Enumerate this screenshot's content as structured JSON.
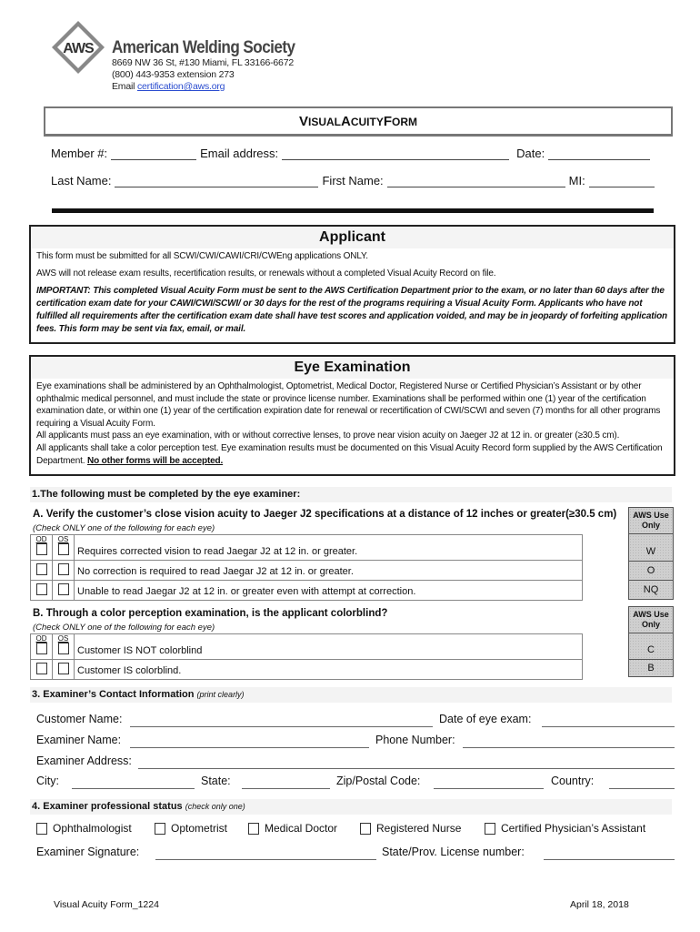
{
  "header": {
    "logo_text": "AWS",
    "org_name": "American Welding Society",
    "address": "8669 NW 36 St, #130 Miami, FL 33166-6672",
    "phone": "(800) 443-9353 extension 273",
    "email_label": "Email",
    "email": "certification@aws.org"
  },
  "form_title": {
    "first_v": "V",
    "rest1": "ISUAL ",
    "first_a": "A",
    "rest2": "CUITY ",
    "first_f": "F",
    "rest3": "ORM"
  },
  "top_fields": {
    "member": "Member #:",
    "email": "Email address:",
    "date": "Date:",
    "last_name": "Last Name:",
    "first_name": "First Name:",
    "mi": "MI:"
  },
  "applicant": {
    "heading": "Applicant",
    "p1": "This form must be submitted for all SCWI/CWI/CAWI/CRI/CWEng applications ONLY.",
    "p2": "AWS will not release exam results, recertification results, or renewals without a completed Visual Acuity Record on file.",
    "p3": "IMPORTANT: This completed Visual Acuity Form must be sent to the AWS Certification Department prior to the exam, or no later than 60 days after the certification exam date for your CAWI/CWI/SCWI/ or 30 days for the rest of the programs requiring a Visual Acuity Form. Applicants who have not fulfilled all requirements after the certification exam date shall have test scores and application voided, and may be in jeopardy of forfeiting application fees. This form may be sent via fax, email, or mail."
  },
  "eye_exam": {
    "heading": "Eye Examination",
    "p1": "Eye examinations shall be administered by an Ophthalmologist, Optometrist, Medical Doctor, Registered Nurse or Certified Physician’s Assistant or by other ophthalmic medical personnel, and must include the state or province license number.  Examinations shall be performed within one (1) year of the certification examination date, or within one (1) year of the certification expiration date for renewal or recertification of CWI/SCWI and seven (7) months for all other programs requiring a Visual Acuity Form.",
    "p2": "All applicants must pass an eye examination, with or without corrective lenses, to prove near vision acuity on Jaeger J2 at 12 in. or greater (≥30.5 cm).",
    "p3": "All applicants shall take a color perception test. Eye examination results must be documented on this Visual Acuity Record form supplied by the AWS Certification Department.",
    "p3_emph": "No other forms will be accepted."
  },
  "section1": {
    "band": "1.The following must be completed by the eye examiner:",
    "qa_title": "A. Verify the customer’s close vision acuity to Jaeger J2 specifications at a distance of 12 inches or greater(≥30.5 cm)",
    "qa_sub": "(Check ONLY one of the following for each eye)",
    "col_od": "OD",
    "col_os": "OS",
    "qa_options": [
      "Requires corrected vision to read Jaegar J2 at 12 in. or greater.",
      "No correction is required to read Jaegar J2 at 12 in. or greater.",
      "Unable to read Jaegar J2 at 12 in. or greater even with attempt at correction."
    ],
    "qa_aws_use": {
      "header": "AWS Use Only",
      "codes": [
        "W",
        "O",
        "NQ"
      ]
    },
    "qb_title": "B. Through a color perception examination, is the applicant colorblind?",
    "qb_sub": "(Check ONLY one of the following for each eye)",
    "qb_options": [
      "Customer IS NOT colorblind",
      "Customer IS colorblind."
    ],
    "qb_aws_use": {
      "header": "AWS Use Only",
      "codes": [
        "C",
        "B"
      ]
    }
  },
  "section3": {
    "band": "3. Examiner’s Contact Information",
    "band_note": "(print clearly)",
    "customer_name": "Customer Name:",
    "date_exam": "Date of eye exam:",
    "examiner_name": "Examiner Name:",
    "phone": "Phone Number:",
    "address": "Examiner Address:",
    "city": "City:",
    "state": "State:",
    "zip": "Zip/Postal Code:",
    "country": "Country:"
  },
  "section4": {
    "band": "4. Examiner professional status",
    "band_note": "(check only one)",
    "options": [
      "Ophthalmologist",
      "Optometrist",
      "Medical Doctor",
      "Registered Nurse",
      "Certified Physician’s Assistant"
    ],
    "signature": "Examiner Signature:",
    "license": "State/Prov. License number:"
  },
  "footer": {
    "left": "Visual Acuity Form_1224",
    "right": "April 18, 2018"
  }
}
